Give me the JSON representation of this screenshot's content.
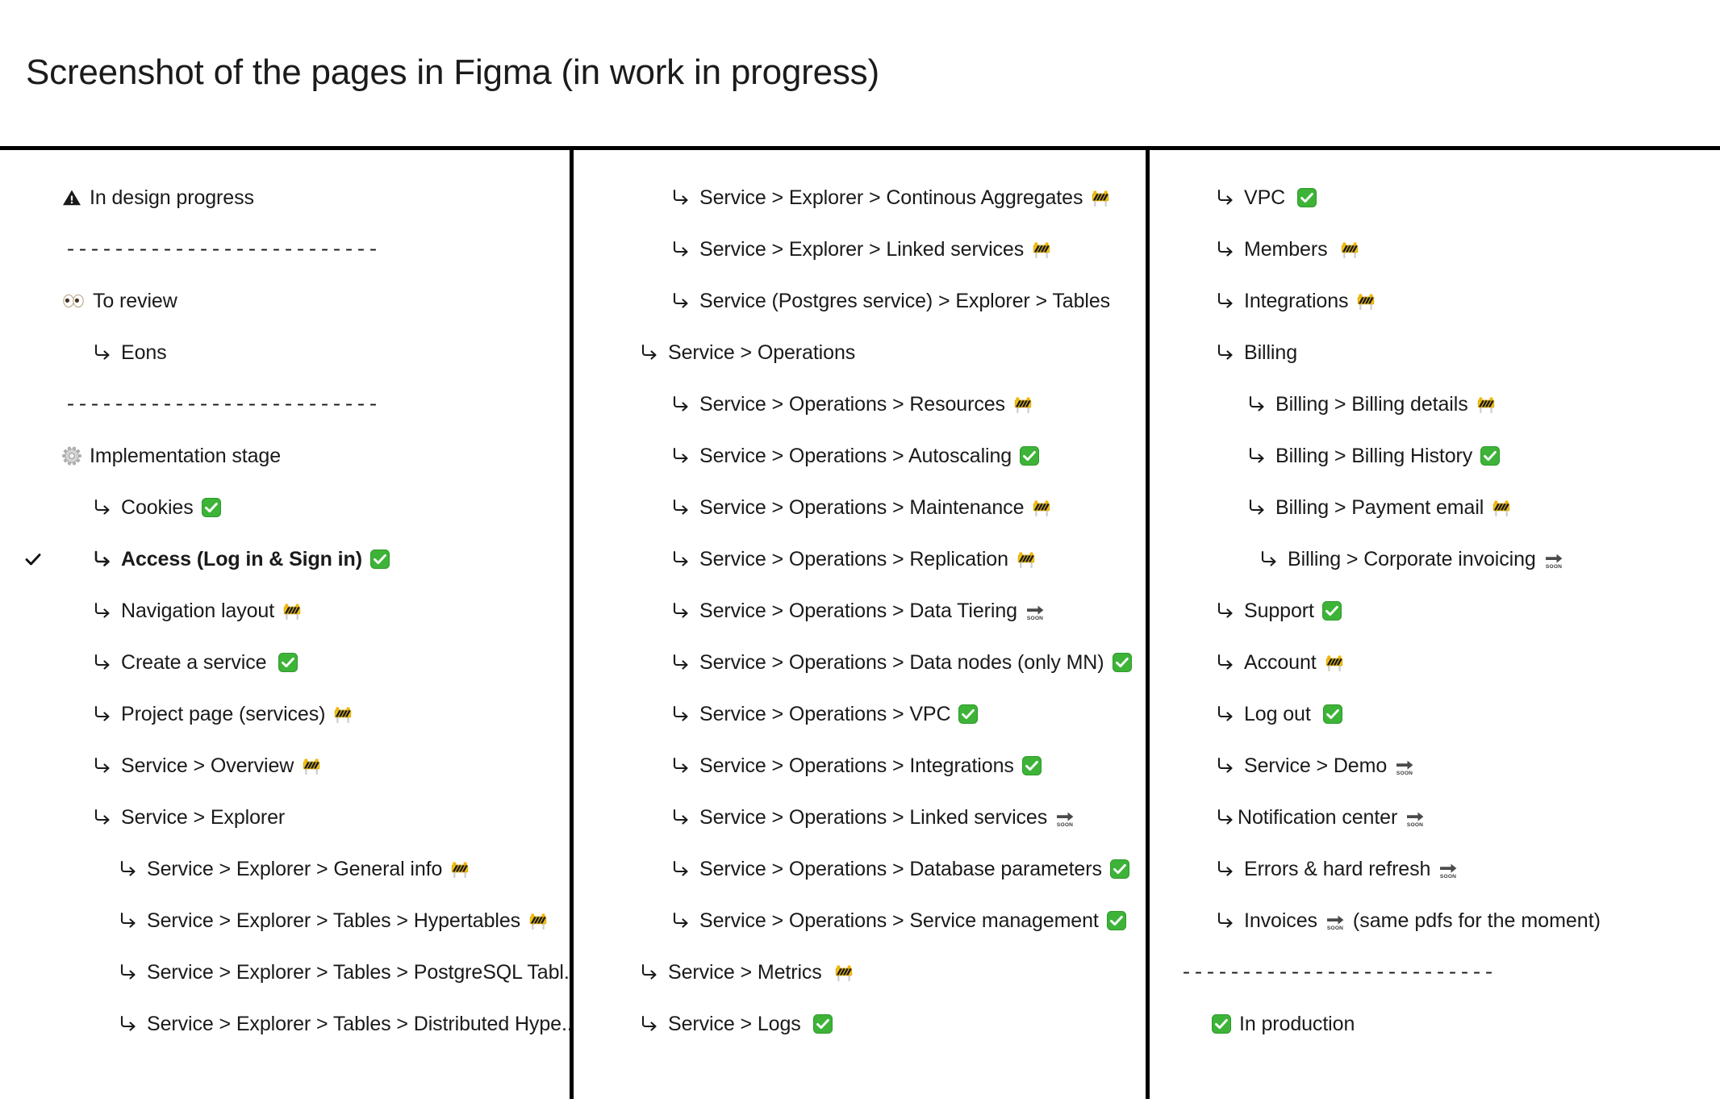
{
  "header": {
    "title": "Screenshot of the pages in Figma (in work in progress)"
  },
  "legend": {
    "warning_icon": "warning-triangle-icon",
    "eyes_icon": "eyes-icon",
    "gear_icon": "gear-icon",
    "check_icon": "white-check-mark-icon",
    "construction_icon": "construction-barrier-icon",
    "soon_icon": "soon-arrow-icon",
    "separator_text": "--------------------------"
  },
  "colors": {
    "check_green": "#3db338",
    "construction_yellow": "#f2c018",
    "text": "#1a1a1a",
    "rule": "#000000"
  },
  "columns": [
    {
      "name": "column-1",
      "blocks": [
        {
          "type": "heading",
          "icon": "warning-triangle-icon",
          "label": "In design progress"
        },
        {
          "type": "separator",
          "text": "--------------------------"
        },
        {
          "type": "heading",
          "icon": "eyes-icon",
          "label": "To review"
        },
        {
          "type": "item",
          "indent": 1,
          "label": "Eons",
          "status": "none"
        },
        {
          "type": "separator",
          "text": "--------------------------"
        },
        {
          "type": "heading",
          "icon": "gear-icon",
          "label": "Implementation stage"
        },
        {
          "type": "item",
          "indent": 1,
          "label": "Cookies",
          "status": "done"
        },
        {
          "type": "item",
          "indent": 1,
          "label": "Access (Log in & Sign in)",
          "status": "done",
          "bold": true,
          "selected": true
        },
        {
          "type": "item",
          "indent": 1,
          "label": "Navigation layout",
          "status": "wip"
        },
        {
          "type": "item",
          "indent": 1,
          "label": "Create a service",
          "status": "done",
          "wide_badge": true
        },
        {
          "type": "item",
          "indent": 1,
          "label": "Project page (services)",
          "status": "wip"
        },
        {
          "type": "item",
          "indent": 1,
          "label": "Service > Overview",
          "status": "wip"
        },
        {
          "type": "item",
          "indent": 1,
          "label": "Service > Explorer",
          "status": "none"
        },
        {
          "type": "item",
          "indent": 2,
          "label": "Service > Explorer > General info",
          "status": "wip"
        },
        {
          "type": "item",
          "indent": 2,
          "label": "Service > Explorer > Tables > Hypertables",
          "status": "wip"
        },
        {
          "type": "item",
          "indent": 2,
          "label": "Service > Explorer > Tables > PostgreSQL Tabl...",
          "status": "none"
        },
        {
          "type": "item",
          "indent": 2,
          "label": "Service > Explorer > Tables > Distributed Hype...",
          "status": "none"
        }
      ]
    },
    {
      "name": "column-2",
      "blocks": [
        {
          "type": "item",
          "indent": "b",
          "label": "Service > Explorer > Continous Aggregates",
          "status": "wip"
        },
        {
          "type": "item",
          "indent": "b",
          "label": "Service > Explorer > Linked services",
          "status": "wip"
        },
        {
          "type": "item",
          "indent": "b",
          "label": "Service (Postgres service)  > Explorer > Tables",
          "status": "none"
        },
        {
          "type": "item",
          "indent": "a",
          "label": "Service > Operations",
          "status": "none"
        },
        {
          "type": "item",
          "indent": "b",
          "label": "Service > Operations > Resources",
          "status": "wip"
        },
        {
          "type": "item",
          "indent": "b",
          "label": "Service > Operations > Autoscaling",
          "status": "done"
        },
        {
          "type": "item",
          "indent": "b",
          "label": "Service > Operations > Maintenance",
          "status": "wip"
        },
        {
          "type": "item",
          "indent": "b",
          "label": "Service > Operations >  Replication",
          "status": "wip"
        },
        {
          "type": "item",
          "indent": "b",
          "label": "Service > Operations >  Data Tiering",
          "status": "soon"
        },
        {
          "type": "item",
          "indent": "b",
          "label": "Service > Operations >  Data nodes (only MN)",
          "status": "done"
        },
        {
          "type": "item",
          "indent": "b",
          "label": "Service > Operations >  VPC",
          "status": "done"
        },
        {
          "type": "item",
          "indent": "b",
          "label": "Service > Operations >  Integrations",
          "status": "done"
        },
        {
          "type": "item",
          "indent": "b",
          "label": "Service > Operations >  Linked services",
          "status": "soon"
        },
        {
          "type": "item",
          "indent": "b",
          "label": "Service > Operations >  Database parameters",
          "status": "done"
        },
        {
          "type": "item",
          "indent": "b",
          "label": "Service > Operations >  Service management",
          "status": "done"
        },
        {
          "type": "item",
          "indent": "a",
          "label": "Service > Metrics",
          "status": "wip",
          "wide_badge": true
        },
        {
          "type": "item",
          "indent": "a",
          "label": "Service > Logs",
          "status": "done",
          "wide_badge": true
        }
      ]
    },
    {
      "name": "column-3",
      "blocks": [
        {
          "type": "item",
          "indent": "a",
          "label": "VPC",
          "status": "done",
          "wide_badge": true
        },
        {
          "type": "item",
          "indent": "a",
          "label": "Members",
          "status": "wip",
          "wide_badge": true
        },
        {
          "type": "item",
          "indent": "a",
          "label": "Integrations",
          "status": "wip"
        },
        {
          "type": "item",
          "indent": "a",
          "label": "Billing",
          "status": "none"
        },
        {
          "type": "item",
          "indent": "b",
          "label": "Billing > Billing details",
          "status": "wip"
        },
        {
          "type": "item",
          "indent": "b",
          "label": "Billing > Billing History",
          "status": "done"
        },
        {
          "type": "item",
          "indent": "b",
          "label": "Billing > Payment email",
          "status": "wip"
        },
        {
          "type": "item",
          "indent": "c",
          "label": "Billing > Corporate invoicing",
          "status": "soon"
        },
        {
          "type": "item",
          "indent": "a",
          "label": "Support",
          "status": "done"
        },
        {
          "type": "item",
          "indent": "a",
          "label": "Account",
          "status": "wip"
        },
        {
          "type": "item",
          "indent": "a",
          "label": "Log out",
          "status": "done",
          "wide_badge": true
        },
        {
          "type": "item",
          "indent": "a",
          "label": "Service > Demo",
          "status": "soon"
        },
        {
          "type": "item",
          "indent": "a",
          "label": "Notification center",
          "status": "soon",
          "tight_arrow": true
        },
        {
          "type": "item",
          "indent": "a",
          "label": "Errors & hard refresh",
          "status": "soon"
        },
        {
          "type": "item",
          "indent": "a",
          "label": "Invoices",
          "status": "soon",
          "trailing": "(same pdfs for the moment)"
        },
        {
          "type": "separator",
          "text": "--------------------------"
        },
        {
          "type": "heading",
          "icon": "white-check-mark-icon",
          "label": "In production"
        }
      ]
    }
  ]
}
